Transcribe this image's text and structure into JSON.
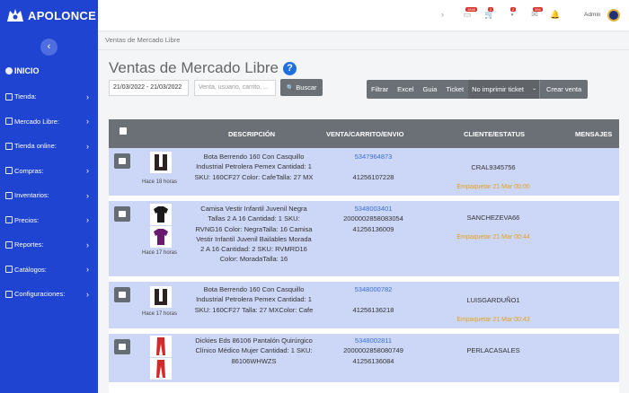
{
  "brand": {
    "name": "APOLONCE"
  },
  "sidebar": {
    "home_label": "INICIO",
    "items": [
      {
        "label": "Tienda:",
        "icon": "store-icon"
      },
      {
        "label": "Mercado Libre:",
        "icon": "handshake-icon"
      },
      {
        "label": "Tienda online:",
        "icon": "shop-icon"
      },
      {
        "label": "Compras:",
        "icon": "cart-icon"
      },
      {
        "label": "Inventarios:",
        "icon": "truck-icon"
      },
      {
        "label": "Precios:",
        "icon": "dollar-icon"
      },
      {
        "label": "Reportes:",
        "icon": "chart-icon"
      },
      {
        "label": "Catálogos:",
        "icon": "folder-icon"
      },
      {
        "label": "Configuraciones:",
        "icon": "gear-icon"
      }
    ]
  },
  "topbar": {
    "badges": [
      "1848",
      "2",
      "2",
      "394"
    ],
    "user": "Admin"
  },
  "breadcrumb": "Ventas de Mercado Libre",
  "page_title": "Ventas de Mercado Libre",
  "filters": {
    "date_range": "21/03/2022 - 21/03/2022",
    "search_placeholder": "Venta, usuario, carrito, ...",
    "search_button": "Buscar"
  },
  "actions": {
    "filtrar": "Filtrar",
    "excel": "Excel",
    "guia": "Guia",
    "ticket": "Ticket",
    "ticket_select": "No imprimir ticket",
    "crear_venta": "Crear venta"
  },
  "table": {
    "headers": {
      "descripcion": "DESCRIPCIÓN",
      "venta": "VENTA/CARRITO/ENVIO",
      "cliente": "CLIENTE/ESTATUS",
      "mensajes": "MENSAJES"
    },
    "rows": [
      {
        "time": "Hace 18 horas",
        "thumbs": [
          "boot-image"
        ],
        "desc": "Bota Berrendo 160 Con Casquillo Industrial Petrolera Pemex Cantidad: 1 SKU: 160CF27 Color: CafeTalla: 27 MX",
        "venta": "5347964873",
        "carrito": "",
        "envio": "41256107228",
        "cliente": "CRAL9345756",
        "status": "Empaquetar 21 Mar 00:00"
      },
      {
        "time": "Hace 17 horas",
        "thumbs": [
          "shirt-black-image",
          "shirt-purple-image"
        ],
        "desc": "Camisa Vestir Infantil Juvenil Negra Tallas 2 A 16 Cantidad: 1 SKU: RVNG16 Color: NegraTalla: 16 Camisa Vestir Infantil Juvenil Bailables Morada 2 A 16 Cantidad: 2 SKU: RVMRD16 Color: MoradaTalla: 16",
        "venta": "5348003401",
        "carrito": "2000002858083054",
        "envio": "41256136009",
        "cliente": "SANCHEZEVA66",
        "status": "Empaquetar 21 Mar 00:44"
      },
      {
        "time": "Hace 17 horas",
        "thumbs": [
          "boot-image"
        ],
        "desc": "Bota Berrendo 160 Con Casquillo Industrial Petrolera Pemex Cantidad: 1 SKU: 160CF27 Talla: 27 MXColor: Cafe",
        "venta": "5348000782",
        "carrito": "",
        "envio": "41256136218",
        "cliente": "LUISGARDUÑO1",
        "status": "Empaquetar 21 Mar 00:43"
      },
      {
        "time": "",
        "thumbs": [
          "pants-red-image",
          "pants-red-image"
        ],
        "desc": "Dickies Eds 86106 Pantalón Quirúrgico Clínico Médico Mujer Cantidad: 1 SKU: 86106WHWZS",
        "venta": "5348002811",
        "carrito": "2000002858080749",
        "envio": "41256136084",
        "cliente": "PERLACASALES",
        "status": ""
      }
    ]
  },
  "colors": {
    "sidebar": "#1f44d2",
    "header": "#6b7077",
    "row": "#ccd6f6",
    "status": "#e5a21d",
    "link": "#3a6fd8"
  }
}
